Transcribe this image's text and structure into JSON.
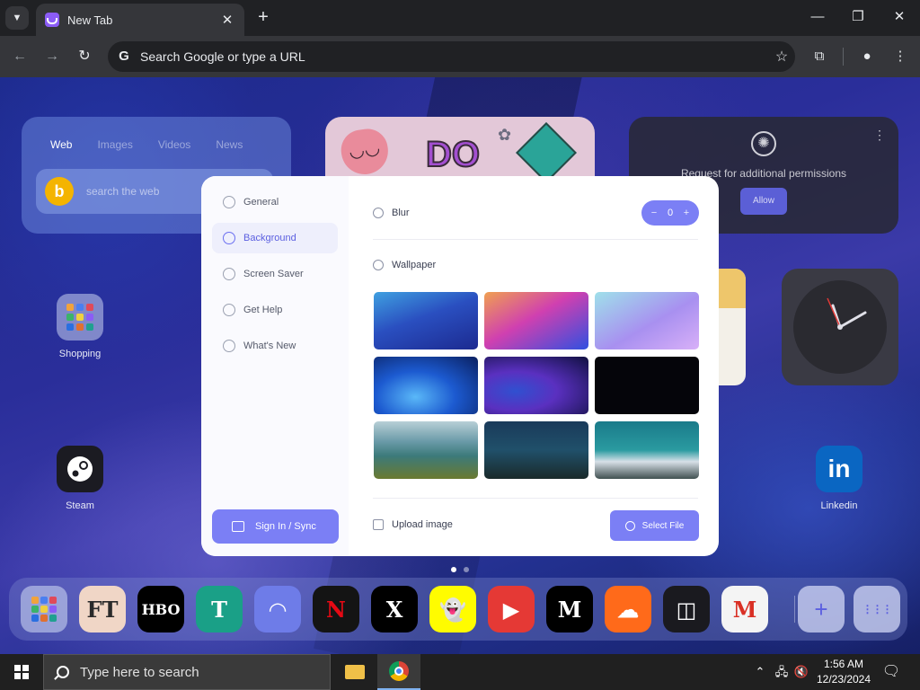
{
  "browser": {
    "tab_title": "New Tab",
    "omnibox_placeholder": "Search Google or type a URL"
  },
  "search_widget": {
    "tabs": [
      "Web",
      "Images",
      "Videos",
      "News"
    ],
    "active_tab": "Web",
    "placeholder": "search the web"
  },
  "permission_widget": {
    "message": "Request for additional permissions",
    "allow_label": "Allow"
  },
  "shortcuts": {
    "shopping": "Shopping",
    "steam": "Steam",
    "linkedin": "Linkedin"
  },
  "dock": {
    "apps": [
      {
        "name": "ft",
        "label": "FT",
        "bg": "#f0d6c6",
        "fg": "#2a2a2a"
      },
      {
        "name": "hbo",
        "label": "HBO",
        "bg": "#000000",
        "fg": "#ffffff"
      },
      {
        "name": "telegraph",
        "label": "T",
        "bg": "#1aa087",
        "fg": "#ffffff"
      },
      {
        "name": "discord",
        "label": "◠",
        "bg": "#6e7ce8",
        "fg": "#ffffff"
      },
      {
        "name": "netflix",
        "label": "N",
        "bg": "#141414",
        "fg": "#e50914"
      },
      {
        "name": "x",
        "label": "X",
        "bg": "#000000",
        "fg": "#ffffff"
      },
      {
        "name": "snapchat",
        "label": "👻",
        "bg": "#fffc00",
        "fg": "#000000"
      },
      {
        "name": "youtube",
        "label": "▶",
        "bg": "#e53935",
        "fg": "#ffffff"
      },
      {
        "name": "medium",
        "label": "M",
        "bg": "#000000",
        "fg": "#ffffff"
      },
      {
        "name": "soundcloud",
        "label": "☁",
        "bg": "#ff6a1a",
        "fg": "#ffffff"
      },
      {
        "name": "twitch",
        "label": "◫",
        "bg": "#1a1a1f",
        "fg": "#ffffff"
      },
      {
        "name": "gmail",
        "label": "M",
        "bg": "#f4f4f4",
        "fg": "#d93025"
      }
    ],
    "add_label": "+",
    "grid_label": "⋮⋮⋮"
  },
  "settings": {
    "menu": [
      {
        "label": "General",
        "active": false
      },
      {
        "label": "Background",
        "active": true
      },
      {
        "label": "Screen Saver",
        "active": false
      },
      {
        "label": "Get Help",
        "active": false
      },
      {
        "label": "What's New",
        "active": false
      }
    ],
    "sign_in_label": "Sign In / Sync",
    "blur_label": "Blur",
    "blur_value": "0",
    "wallpaper_label": "Wallpaper",
    "upload_label": "Upload image",
    "select_file_label": "Select File",
    "accent_color": "#7b7ff5"
  },
  "taskbar": {
    "search_placeholder": "Type here to search",
    "time": "1:56 AM",
    "date": "12/23/2024"
  }
}
